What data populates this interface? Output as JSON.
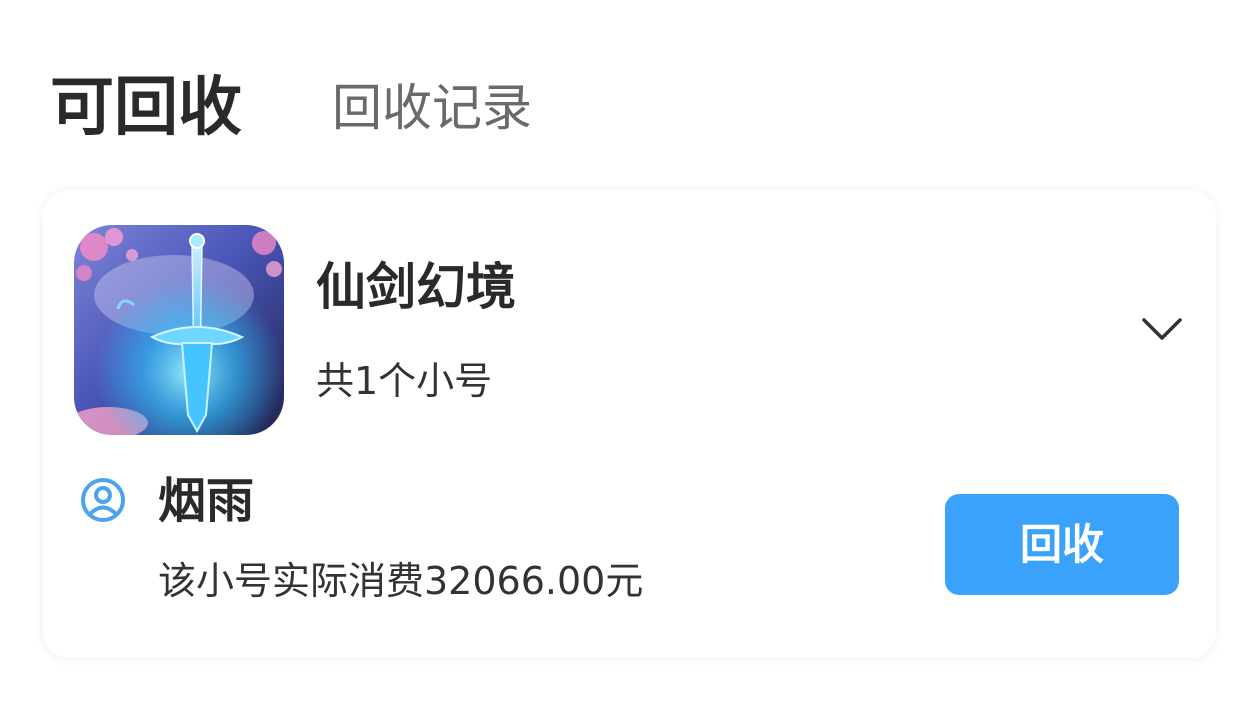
{
  "tabs": {
    "active_label": "可回收",
    "inactive_label": "回收记录"
  },
  "card": {
    "game_name": "仙剑幻境",
    "account_count": "共1个小号",
    "icon": "chevron-down-icon",
    "account": {
      "name": "烟雨",
      "spend_text": "该小号实际消费32066.00元",
      "icon": "user-circle-icon"
    },
    "button_label": "回收"
  },
  "colors": {
    "accent": "#3aa2fa",
    "text_primary": "#2a2a2a",
    "text_secondary": "#6a6a6a",
    "user_icon": "#4ca3ee"
  }
}
